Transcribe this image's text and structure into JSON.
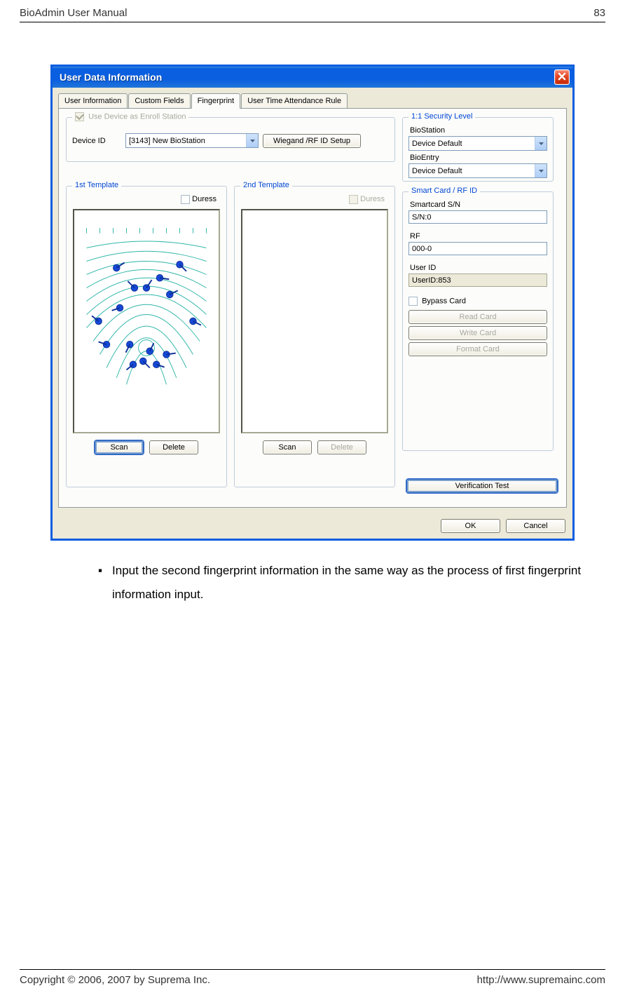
{
  "header": {
    "doc_title": "BioAdmin User Manual",
    "page_number": "83"
  },
  "dialog": {
    "title": "User Data Information",
    "tabs": [
      {
        "label": "User Information"
      },
      {
        "label": "Custom Fields"
      },
      {
        "label": "Fingerprint"
      },
      {
        "label": "User Time Attendance Rule"
      }
    ],
    "enroll": {
      "legend": "Use Device as Enroll Station",
      "device_id_label": "Device ID",
      "device_value": "[3143] New BioStation",
      "wiegand_btn": "Wiegand /RF ID Setup"
    },
    "security": {
      "legend": "1:1 Security Level",
      "biostation_label": "BioStation",
      "biostation_value": "Device Default",
      "bioentry_label": "BioEntry",
      "bioentry_value": "Device Default"
    },
    "template1": {
      "legend": "1st Template",
      "duress_label": "Duress",
      "scan_btn": "Scan",
      "delete_btn": "Delete"
    },
    "template2": {
      "legend": "2nd Template",
      "duress_label": "Duress",
      "scan_btn": "Scan",
      "delete_btn": "Delete"
    },
    "card": {
      "legend": "Smart Card / RF ID",
      "sn_label": "Smartcard S/N",
      "sn_value": "S/N:0",
      "rf_label": "RF",
      "rf_value": "000-0",
      "userid_label": "User ID",
      "userid_value": "UserID:853",
      "bypass_label": "Bypass Card",
      "read_btn": "Read Card",
      "write_btn": "Write Card",
      "format_btn": "Format Card"
    },
    "verify_btn": "Verification Test",
    "ok_btn": "OK",
    "cancel_btn": "Cancel"
  },
  "instruction_text": "Input the second fingerprint information in the same way as the process of first fingerprint information input.",
  "footer": {
    "copyright": "Copyright © 2006, 2007 by Suprema Inc.",
    "url": "http://www.supremainc.com"
  }
}
